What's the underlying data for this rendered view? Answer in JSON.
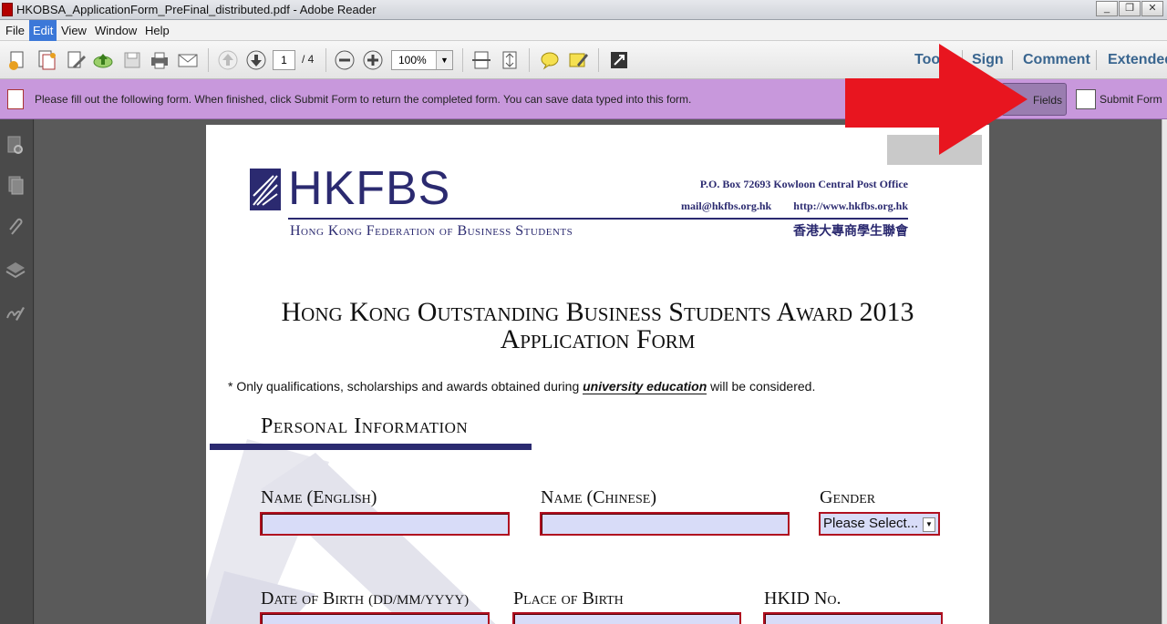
{
  "window": {
    "title": "HKOBSA_ApplicationForm_PreFinal_distributed.pdf - Adobe Reader",
    "controls": [
      "_",
      "❐",
      "✕"
    ]
  },
  "menu": [
    "File",
    "Edit",
    "View",
    "Window",
    "Help"
  ],
  "toolbar": {
    "page_current": "1",
    "page_total": "/ 4",
    "zoom": "100%",
    "tools_label": "Tools",
    "sign_label": "Sign",
    "comment_label": "Comment",
    "extended_label": "Extended"
  },
  "formbar": {
    "message": "Please fill out the following form. When finished, click Submit Form to return the completed form. You can save data typed into this form.",
    "highlight_label": "Fields",
    "submit_label": "Submit Form"
  },
  "document": {
    "org_short": "HKFBS",
    "org_full": "Hong Kong Federation of Business Students",
    "po_box": "P.O. Box 72693 Kowloon Central Post Office",
    "email": "mail@hkfbs.org.hk",
    "website": "http://www.hkfbs.org.hk",
    "chinese_name": "香港大專商學生聯會",
    "title_line1": "Hong Kong Outstanding Business Students Award 2013",
    "title_line2": "Application Form",
    "note_prefix": "* Only qualifications, scholarships and awards obtained during ",
    "note_emphasis": "university education",
    "note_suffix": " will be considered.",
    "section_title": "Personal Information",
    "labels": {
      "name_english": "Name (English)",
      "name_chinese": "Name (Chinese)",
      "gender": "Gender",
      "dob": "Date of Birth",
      "dob_format": "(DD/MM/YYYY)",
      "place_of_birth": "Place of Birth",
      "hkid": "HKID No."
    },
    "gender_select": "Please Select...",
    "accent_color": "#2b2a70",
    "field_border_color": "#b01020",
    "field_fill_color": "#d8dcf8"
  },
  "annotation_color": "#e8151f"
}
